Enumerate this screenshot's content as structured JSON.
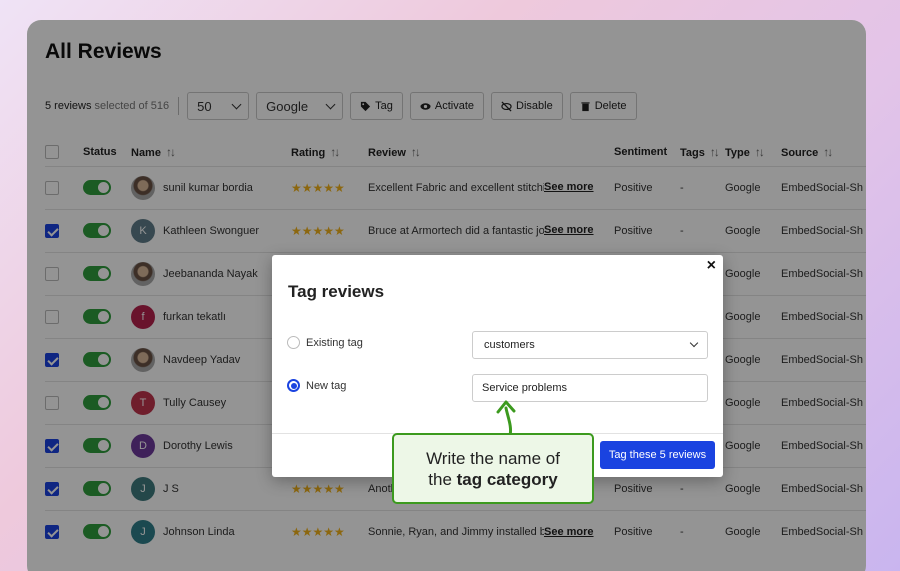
{
  "page": {
    "title": "All Reviews"
  },
  "toolbar": {
    "selected_count": "5 reviews",
    "selected_suffix": "selected of 516",
    "page_size": "50",
    "source_filter": "Google",
    "tag_label": "Tag",
    "activate_label": "Activate",
    "disable_label": "Disable",
    "delete_label": "Delete"
  },
  "table": {
    "headers": {
      "status": "Status",
      "name": "Name",
      "rating": "Rating",
      "review": "Review",
      "sentiment": "Sentiment",
      "tags": "Tags",
      "type": "Type",
      "source": "Source"
    },
    "see_more": "See more",
    "rows": [
      {
        "checked": false,
        "avatar": "photo",
        "initial": "",
        "avatar_color": "#8a8a8a",
        "name": "sunil kumar bordia",
        "stars": "★★★★★",
        "review": "Excellent Fabric and excellent stitching",
        "sentiment": "Positive",
        "tags": "-",
        "type": "Google",
        "source": "EmbedSocial-Sh"
      },
      {
        "checked": true,
        "avatar": "initial",
        "initial": "K",
        "avatar_color": "#5f7d8a",
        "name": "Kathleen Swonguer",
        "stars": "★★★★★",
        "review": "Bruce at Armortech did a fantastic job",
        "sentiment": "Positive",
        "tags": "-",
        "type": "Google",
        "source": "EmbedSocial-Sh"
      },
      {
        "checked": false,
        "avatar": "photo",
        "initial": "",
        "avatar_color": "#8a8a8a",
        "name": "Jeebananda Nayak",
        "stars": "",
        "review": "",
        "sentiment": "",
        "tags": "",
        "type": "Google",
        "source": "EmbedSocial-Sh"
      },
      {
        "checked": false,
        "avatar": "initial",
        "initial": "f",
        "avatar_color": "#b5224d",
        "name": "furkan tekatlı",
        "stars": "",
        "review": "",
        "sentiment": "",
        "tags": "",
        "type": "Google",
        "source": "EmbedSocial-Sh"
      },
      {
        "checked": true,
        "avatar": "photo",
        "initial": "",
        "avatar_color": "#8a8a8a",
        "name": "Navdeep Yadav",
        "stars": "",
        "review": "",
        "sentiment": "",
        "tags": "",
        "type": "Google",
        "source": "EmbedSocial-Sh"
      },
      {
        "checked": false,
        "avatar": "initial",
        "initial": "T",
        "avatar_color": "#c0344c",
        "name": "Tully Causey",
        "stars": "",
        "review": "",
        "sentiment": "",
        "tags": "",
        "type": "Google",
        "source": "EmbedSocial-Sh"
      },
      {
        "checked": true,
        "avatar": "initial",
        "initial": "D",
        "avatar_color": "#6d3a9c",
        "name": "Dorothy Lewis",
        "stars": "",
        "review": "",
        "sentiment": "",
        "tags": "",
        "type": "Google",
        "source": "EmbedSocial-Sh"
      },
      {
        "checked": true,
        "avatar": "initial",
        "initial": "J",
        "avatar_color": "#3f7a7e",
        "name": "J S",
        "stars": "★★★★★",
        "review": "Anoth",
        "sentiment": "Positive",
        "tags": "-",
        "type": "Google",
        "source": "EmbedSocial-Sh"
      },
      {
        "checked": true,
        "avatar": "initial",
        "initial": "J",
        "avatar_color": "#2f7f8a",
        "name": "Johnson Linda",
        "stars": "★★★★★",
        "review": "Sonnie, Ryan, and Jimmy installed b",
        "sentiment": "Positive",
        "tags": "-",
        "type": "Google",
        "source": "EmbedSocial-Sh"
      }
    ]
  },
  "modal": {
    "title": "Tag reviews",
    "close": "×",
    "existing_label": "Existing tag",
    "existing_value": "customers",
    "new_label": "New tag",
    "new_value": "Service problems",
    "submit_label": "Tag these 5 reviews"
  },
  "callout": {
    "line1": "Write the name of",
    "line2_prefix": "the ",
    "line2_bold": "tag category"
  },
  "colors": {
    "accent": "#1a43e0",
    "toggle_on": "#2f9d3d",
    "callout_border": "#3c9a1e",
    "callout_bg": "#edf7e7"
  }
}
